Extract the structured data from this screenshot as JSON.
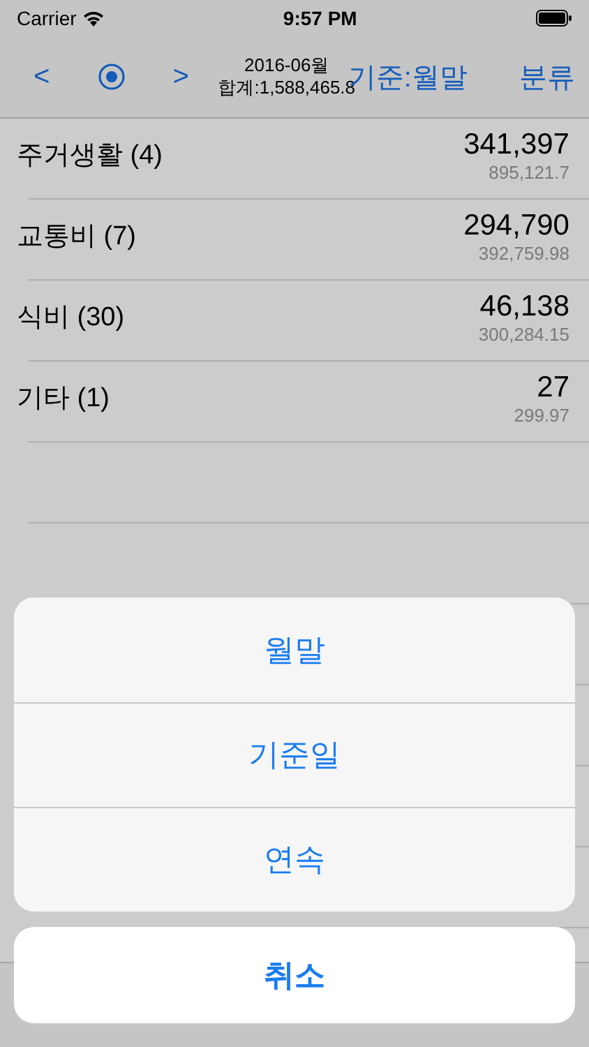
{
  "status_bar": {
    "carrier": "Carrier",
    "time": "9:57 PM"
  },
  "nav_bar": {
    "prev": "<",
    "next": ">",
    "period": "2016-06월",
    "total": "합계:1,588,465.8",
    "basis_button": "기준:월말",
    "category_button": "분류"
  },
  "rows": [
    {
      "name": "주거생활 (4)",
      "amount": "341,397",
      "sub_amount": "895,121.7"
    },
    {
      "name": "교통비 (7)",
      "amount": "294,790",
      "sub_amount": "392,759.98"
    },
    {
      "name": "식비 (30)",
      "amount": "46,138",
      "sub_amount": "300,284.15"
    },
    {
      "name": "기타 (1)",
      "amount": "27",
      "sub_amount": "299.97"
    }
  ],
  "action_sheet": {
    "options": [
      "월말",
      "기준일",
      "연속"
    ],
    "cancel": "취소"
  }
}
